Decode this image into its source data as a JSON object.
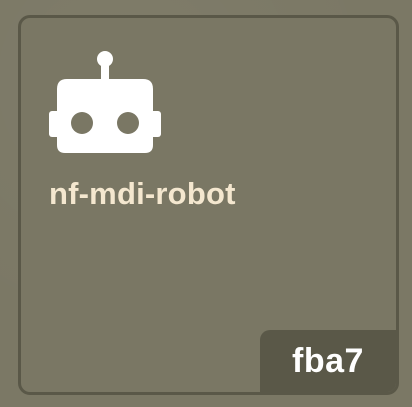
{
  "icon": {
    "name": "robot-icon",
    "color": "#ffffff"
  },
  "title": "nf-mdi-robot",
  "code": "fba7",
  "colors": {
    "background": "#7b7865",
    "card_border": "#5a5848",
    "title_text": "#f4e7cf",
    "badge_background": "#5a5848",
    "badge_text": "#ffffff"
  }
}
